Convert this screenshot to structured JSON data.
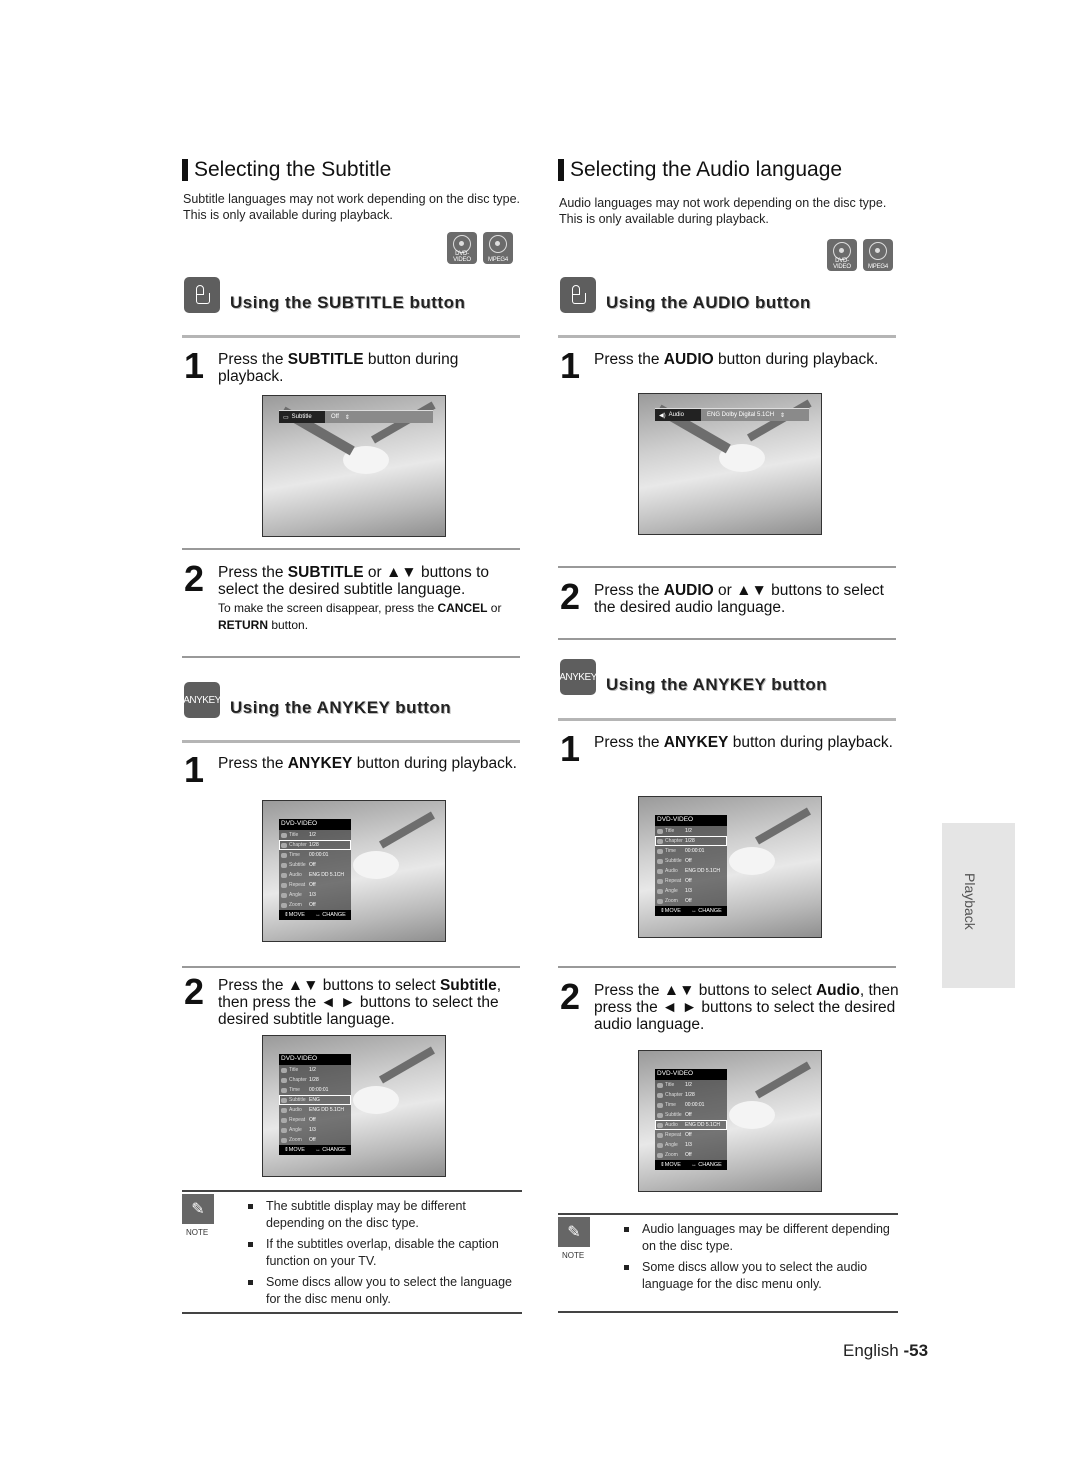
{
  "left": {
    "title": "Selecting the Subtitle",
    "intro": "Subtitle languages may not work depending on the disc type. This is only available during playback.",
    "disc_icons": [
      {
        "name": "disc-icon",
        "label": "DVD-VIDEO"
      },
      {
        "name": "disc-icon",
        "label": "MPEG4"
      }
    ],
    "section1": {
      "icon": "hand-button-icon",
      "title": "Using the SUBTITLE button",
      "step1": {
        "num": "1",
        "pre": "Press the ",
        "bold": "SUBTITLE",
        "post": " button during playback."
      },
      "osd": {
        "key": "Subtitle",
        "value": "Off",
        "arrows": "⇕"
      },
      "step2": {
        "num": "2",
        "pre": "Press the ",
        "bold": "SUBTITLE",
        "post": " or ▲▼ buttons to select the desired subtitle language.",
        "sub_pre": "To make the screen disappear, press the ",
        "sub_bold1": "CANCEL",
        "sub_mid": " or ",
        "sub_bold2": "RETURN",
        "sub_post": " button."
      }
    },
    "section2": {
      "icon_label": "ANYKEY",
      "title": "Using the ANYKEY button",
      "step1": {
        "num": "1",
        "pre": "Press the ",
        "bold": "ANYKEY",
        "post": " button during playback."
      },
      "step2": {
        "num": "2",
        "pre": "Press the ▲▼ buttons to select ",
        "bold": "Subtitle",
        "post": ", then press the ◄ ► buttons to select the desired subtitle language."
      }
    },
    "note": {
      "label": "NOTE",
      "items": [
        "The subtitle display may be different depending on the disc type.",
        "If the subtitles overlap, disable the caption function on your TV.",
        "Some discs allow you to select the language for the disc menu only."
      ]
    }
  },
  "right": {
    "title": "Selecting the Audio language",
    "intro": "Audio languages may not work depending on the disc type. This is only available during playback.",
    "disc_icons": [
      {
        "name": "disc-icon",
        "label": "DVD-VIDEO"
      },
      {
        "name": "disc-icon",
        "label": "MPEG4"
      }
    ],
    "section1": {
      "icon": "hand-button-icon",
      "title": "Using the AUDIO button",
      "step1": {
        "num": "1",
        "pre": "Press the ",
        "bold": "AUDIO",
        "post": " button during playback."
      },
      "osd": {
        "key": "Audio",
        "value": "ENG Dolby Digital 5.1CH",
        "arrows": "⇕"
      },
      "step2": {
        "num": "2",
        "pre": "Press the ",
        "bold": "AUDIO",
        "post": " or ▲▼ buttons to select the desired audio language."
      }
    },
    "section2": {
      "icon_label": "ANYKEY",
      "title": "Using the ANYKEY button",
      "step1": {
        "num": "1",
        "pre": "Press the ",
        "bold": "ANYKEY",
        "post": " button during playback."
      },
      "step2": {
        "num": "2",
        "pre": "Press the ▲▼ buttons to select ",
        "bold": "Audio",
        "post": ", then press the ◄ ► buttons to select the desired audio language."
      }
    },
    "note": {
      "label": "NOTE",
      "items": [
        "Audio languages may be different depending on the disc type.",
        "Some discs allow you to select the audio language for the disc menu only."
      ]
    }
  },
  "menus": {
    "header": "DVD-VIDEO",
    "footer_move": "⇕MOVE",
    "footer_change": "↔ CHANGE",
    "left_a": {
      "selected": "Chapter",
      "rows": [
        [
          "Title",
          "1/2"
        ],
        [
          "Chapter",
          "1/28"
        ],
        [
          "Time",
          "00:00:01"
        ],
        [
          "Subtitle",
          "Off"
        ],
        [
          "Audio",
          "ENG DD 5.1CH"
        ],
        [
          "Repeat",
          "Off"
        ],
        [
          "Angle",
          "1/3"
        ],
        [
          "Zoom",
          "Off"
        ]
      ]
    },
    "left_b": {
      "selected": "Subtitle",
      "rows": [
        [
          "Title",
          "1/2"
        ],
        [
          "Chapter",
          "1/28"
        ],
        [
          "Time",
          "00:00:01"
        ],
        [
          "Subtitle",
          "ENG"
        ],
        [
          "Audio",
          "ENG DD 5.1CH"
        ],
        [
          "Repeat",
          "Off"
        ],
        [
          "Angle",
          "1/3"
        ],
        [
          "Zoom",
          "Off"
        ]
      ]
    },
    "right_a": {
      "selected": "Chapter",
      "rows": [
        [
          "Title",
          "1/2"
        ],
        [
          "Chapter",
          "1/28"
        ],
        [
          "Time",
          "00:00:01"
        ],
        [
          "Subtitle",
          "Off"
        ],
        [
          "Audio",
          "ENG DD 5.1CH"
        ],
        [
          "Repeat",
          "Off"
        ],
        [
          "Angle",
          "1/3"
        ],
        [
          "Zoom",
          "Off"
        ]
      ]
    },
    "right_b": {
      "selected": "Audio",
      "rows": [
        [
          "Title",
          "1/2"
        ],
        [
          "Chapter",
          "1/28"
        ],
        [
          "Time",
          "00:00:01"
        ],
        [
          "Subtitle",
          "Off"
        ],
        [
          "Audio",
          "ENG DD 5.1CH"
        ],
        [
          "Repeat",
          "Off"
        ],
        [
          "Angle",
          "1/3"
        ],
        [
          "Zoom",
          "Off"
        ]
      ]
    }
  },
  "side_tab": "Playback",
  "footer": {
    "lang": "English ",
    "page": "-53"
  }
}
